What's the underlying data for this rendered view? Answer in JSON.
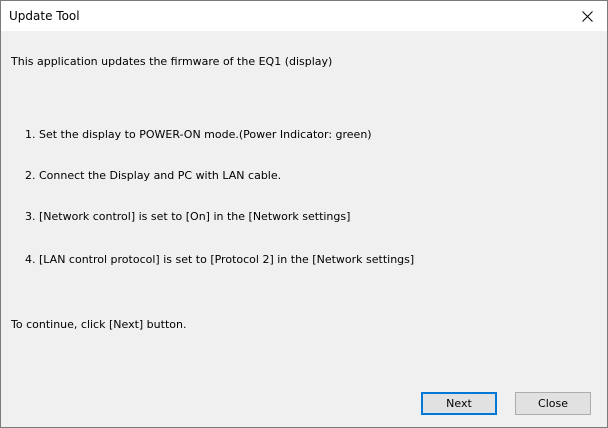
{
  "window": {
    "title": "Update Tool"
  },
  "dialog": {
    "intro": "This application updates the firmware of the EQ1 (display)",
    "steps": [
      "1. Set the display to POWER-ON mode.(Power Indicator: green)",
      "2. Connect the Display and PC with LAN cable.",
      "3. [Network control] is set to [On] in the [Network settings]",
      "4. [LAN control protocol] is set to [Protocol 2] in the [Network settings]"
    ],
    "continue_text": "To continue, click [Next] button."
  },
  "buttons": {
    "next": "Next",
    "close": "Close"
  },
  "icons": {
    "title_close": "close-icon"
  },
  "colors": {
    "dialog_background": "#f0f0f0",
    "titlebar_background": "#ffffff",
    "default_button_border": "#0078d7"
  }
}
